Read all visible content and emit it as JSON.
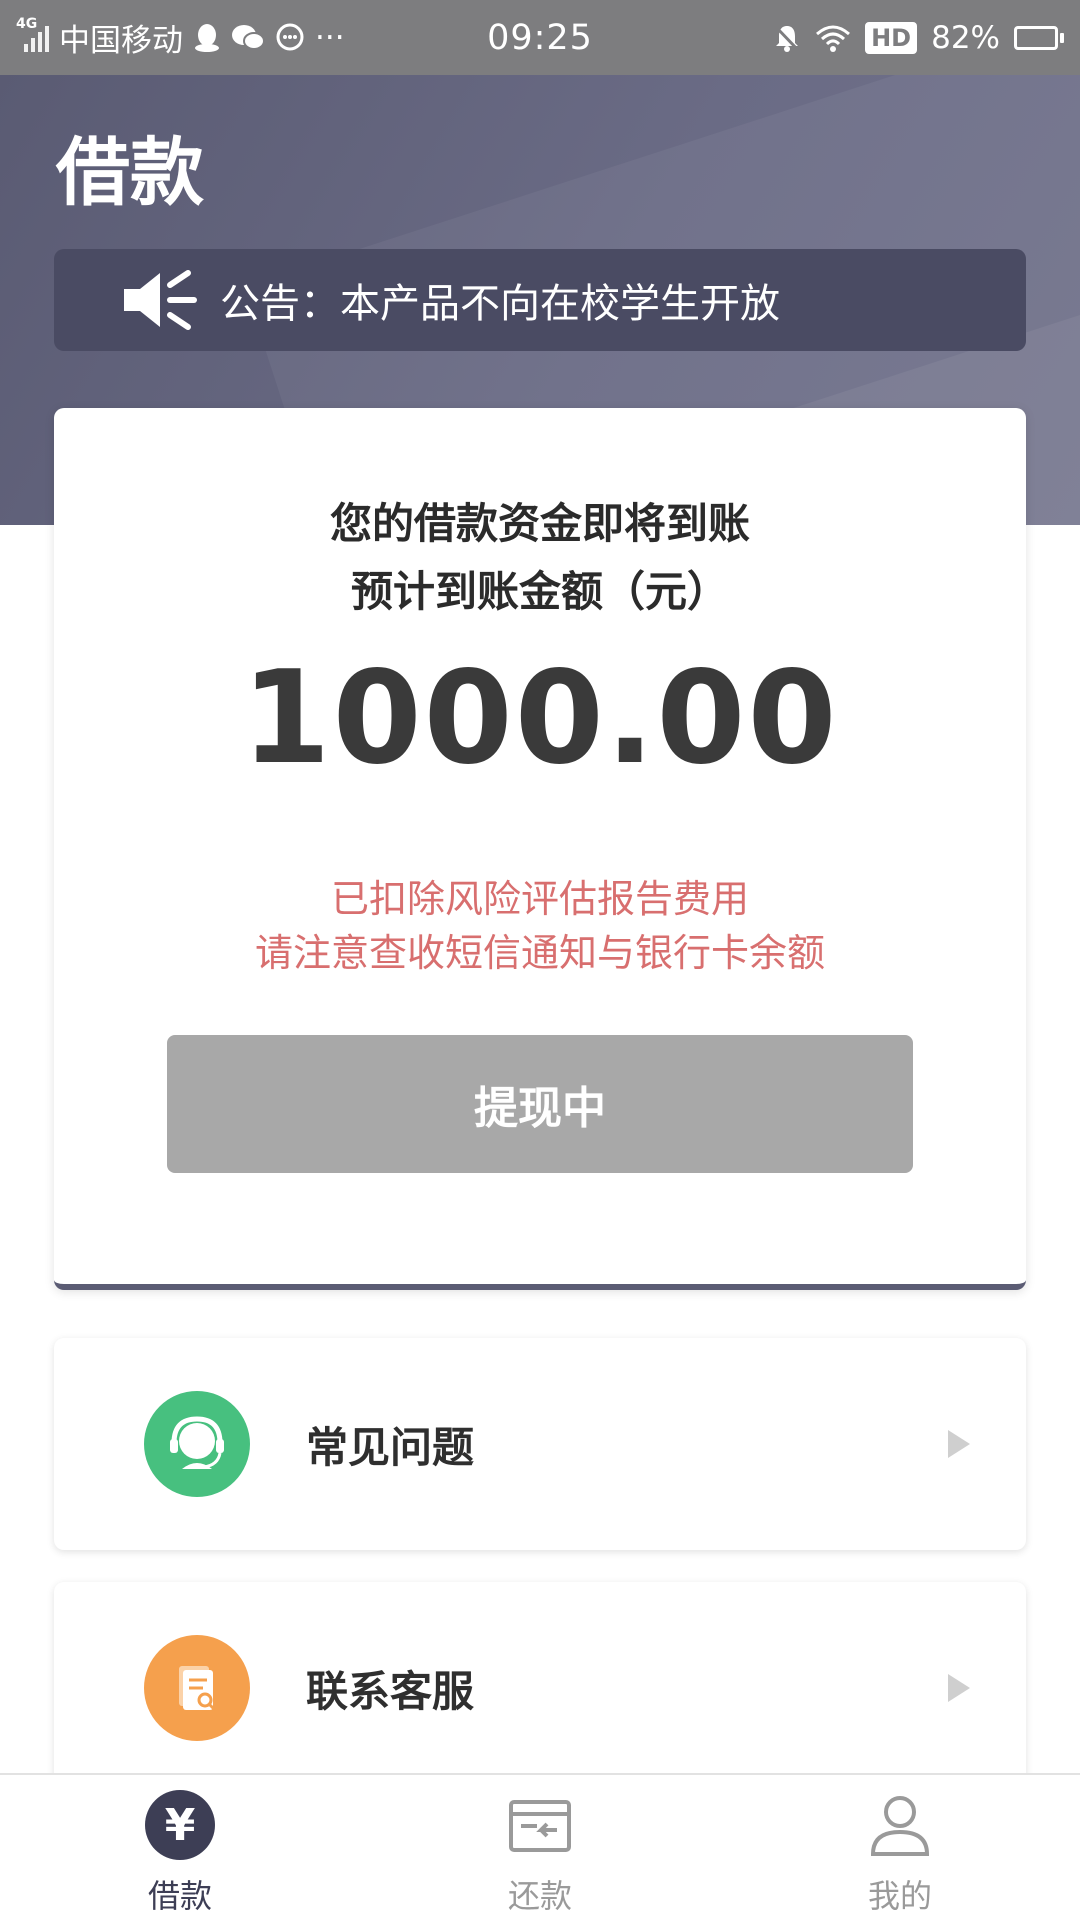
{
  "status_bar": {
    "network": "4G",
    "carrier": "中国移动",
    "dots": "···",
    "time": "09:25",
    "hd": "HD",
    "battery": "82%",
    "battery_level": 0.82
  },
  "header": {
    "title": "借款",
    "notice": "公告：本产品不向在校学生开放"
  },
  "card": {
    "heading": "您的借款资金即将到账",
    "subheading": "预计到账金额（元）",
    "amount": "1000.00",
    "note_line1": "已扣除风险评估报告费用",
    "note_line2": "请注意查收短信通知与银行卡余额",
    "button_label": "提现中"
  },
  "list": [
    {
      "label": "常见问题",
      "icon": "customer-service-icon"
    },
    {
      "label": "联系客服",
      "icon": "document-icon"
    }
  ],
  "bottom_nav": [
    {
      "label": "借款",
      "icon": "yen-icon",
      "active": true
    },
    {
      "label": "还款",
      "icon": "repay-icon",
      "active": false
    },
    {
      "label": "我的",
      "icon": "user-icon",
      "active": false
    }
  ],
  "colors": {
    "brand": "#5a5b73",
    "notice_bg": "#4a4b63",
    "alert_text": "#d86f6f",
    "button_disabled": "#a8a8a8",
    "faq_icon": "#47c07f",
    "contact_icon": "#f5a04d"
  }
}
